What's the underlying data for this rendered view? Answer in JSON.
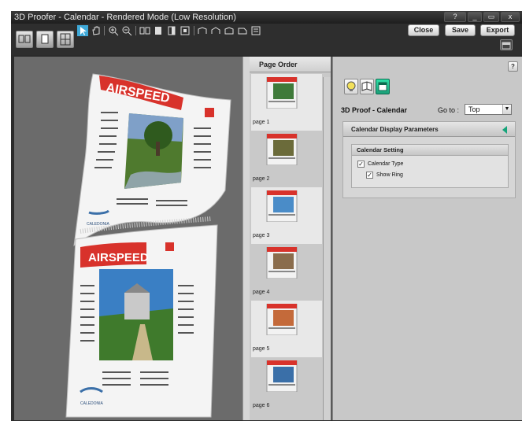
{
  "window": {
    "title": "3D Proofer - Calendar - Rendered Mode (Low Resolution)",
    "controls": {
      "help": "?",
      "minimize": "_",
      "close": "x"
    }
  },
  "toolbar": {
    "close_label": "Close",
    "save_label": "Save",
    "export_label": "Export"
  },
  "calendar": {
    "brand": "AIRSPEED",
    "footer_brand": "CALEDONIA"
  },
  "page_order": {
    "title": "Page Order",
    "pages": [
      {
        "label": "page 1",
        "thumb_color": "#3f7a3a"
      },
      {
        "label": "page 2",
        "thumb_color": "#6b6b3a"
      },
      {
        "label": "page 3",
        "thumb_color": "#4a8cc8"
      },
      {
        "label": "page 4",
        "thumb_color": "#8a6c4c"
      },
      {
        "label": "page 5",
        "thumb_color": "#c46a3a"
      },
      {
        "label": "page 6",
        "thumb_color": "#3a6fa8"
      }
    ]
  },
  "properties": {
    "help": "?",
    "proof_title": "3D Proof - Calendar",
    "goto_label": "Go to :",
    "goto_value": "Top",
    "section_title": "Calendar Display Parameters",
    "subsection_title": "Calendar Setting",
    "options": [
      {
        "label": "Calendar Type",
        "checked": true
      },
      {
        "label": "Show Ring",
        "checked": true
      }
    ]
  },
  "colors": {
    "accent": "#1b9e78",
    "brand_red": "#d8322b"
  }
}
